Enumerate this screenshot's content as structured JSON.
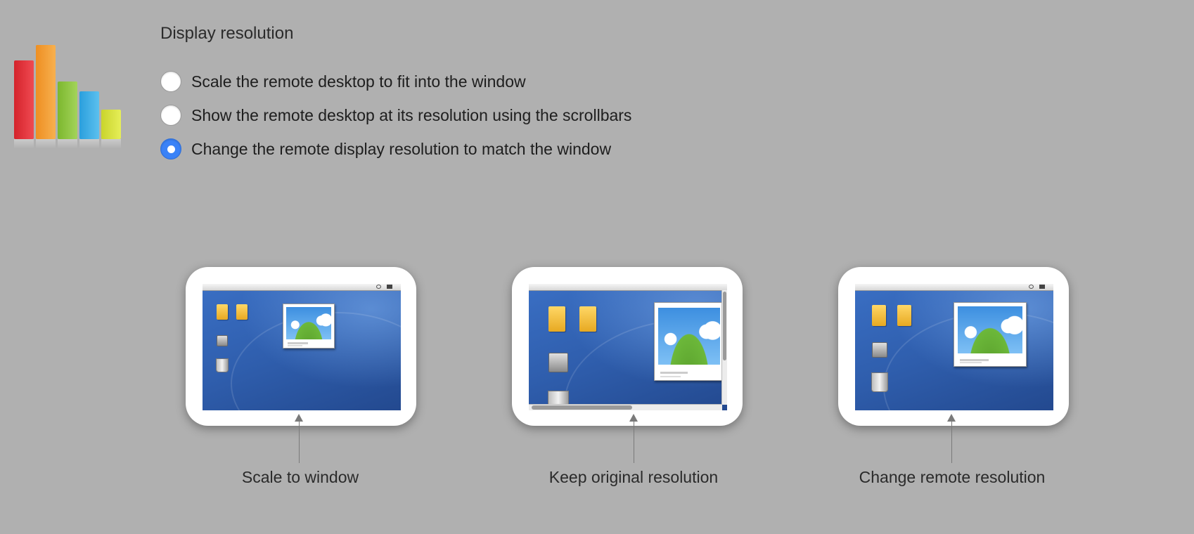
{
  "app": {
    "logo_icon": "bar-chart-logo-icon",
    "logo_colors": [
      "#e8343c",
      "#f5a23a",
      "#8cc63f",
      "#3fb0e8",
      "#d7e23a"
    ]
  },
  "display": {
    "section_title": "Display resolution",
    "options": [
      {
        "label": "Scale the remote desktop to fit into the window",
        "checked": false
      },
      {
        "label": "Show the remote desktop at its resolution using the scrollbars",
        "checked": false
      },
      {
        "label": "Change the remote display resolution to match the window",
        "checked": true
      }
    ],
    "accent_color": "#3a82f7"
  },
  "previews": [
    {
      "caption": "Scale to window"
    },
    {
      "caption": "Keep original resolution"
    },
    {
      "caption": "Change remote resolution"
    }
  ]
}
